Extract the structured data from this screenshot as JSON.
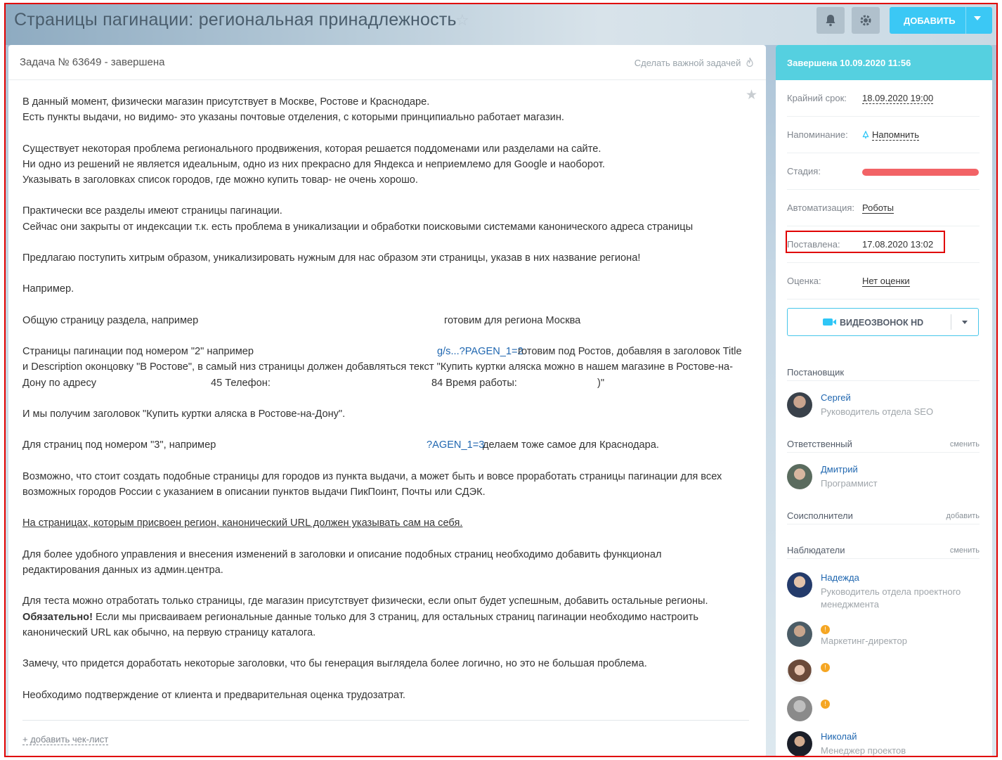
{
  "header": {
    "title": "Страницы пагинации: региональная принадлежность",
    "star_icon": "☆",
    "bell_icon": "bell-icon",
    "gear_icon": "gear-icon",
    "add_button": "ДОБАВИТЬ"
  },
  "task": {
    "number": "Задача № 63649 - завершена",
    "make_important": "Сделать важной задачей",
    "fav_star": "★",
    "lines": {
      "l1": "В данный момент, физически магазин присутствует в Москве, Ростове и Краснодаре.",
      "l2": "Есть пункты выдачи, но видимо- это указаны почтовые отделения, с которыми принципиально работает магазин.",
      "l3": "Существует некоторая проблема регионального продвижения, которая решается поддоменами или разделами на сайте.",
      "l4": "Ни одно из решений не является идеальным, одно из них прекрасно для Яндекса и неприемлемо для Google и наоборот.",
      "l5": "Указывать в заголовках список городов, где можно купить товар- не очень хорошо.",
      "l6": "Практически все разделы имеют страницы пагинации.",
      "l7": "Сейчас они закрыты от индексации т.к. есть проблема в уникализации и обработки поисковыми системами канонического адреса страницы",
      "l8": "Предлагаю поступить хитрым образом, уникализировать нужным для нас образом эти страницы, указав в них название региона!",
      "l9": "Например.",
      "l10a": "Общую страницу раздела, например",
      "l10b": "готовим для региона Москва",
      "l11a": "Страницы пагинации под номером \"2\" например",
      "l11link": "g/s...?PAGEN_1=2",
      "l11b": "готовим под Ростов, добавляя в заголовок Title",
      "l12": "и Description оконцовку \"В Ростове\", в самый низ страницы должен добавляться текст \"Купить куртки аляска можно в нашем магазине в Ростове-на-",
      "l13a": "Дону по адресу",
      "l13b": "45 Телефон:",
      "l13c": "84 Время работы:",
      "l13d": ")\"",
      "l14": "И мы получим заголовок \"Купить куртки аляска в Ростове-на-Дону\".",
      "l15a": "Для страниц под номером \"3\", например",
      "l15link": "?AGEN_1=3",
      "l15b": "делаем тоже самое для Краснодара.",
      "l16": "Возможно, что стоит создать подобные страницы для городов из пункта выдачи, а может быть и вовсе проработать страницы пагинации для всех",
      "l17": "возможных городов России с указанием в описании пунктов выдачи ПикПоинт, Почты или СДЭК.",
      "l18": "На страницах, которым присвоен регион, канонический URL должен указывать сам на себя.",
      "l19": "Для более удобного управления и внесения изменений в заголовки и описание подобных страниц необходимо добавить функционал",
      "l20": "редактирования данных из админ.центра.",
      "l21": "Для теста можно отработать только страницы, где магазин присутствует физически, если опыт будет успешным, добавить остальные регионы.",
      "l22bold": "Обязательно!",
      "l22": " Если мы присваиваем региональные данные только для 3 страниц, для остальных страниц пагинации необходимо настроить",
      "l23": "канонический URL как обычно, на первую страницу каталога.",
      "l24": "Замечу, что придется доработать некоторые заголовки, что бы генерация выглядела более логично, но это не большая проблема.",
      "l25": "Необходимо подтверждение от клиента и предварительная оценка трудозатрат."
    },
    "add_checklist": "+ добавить чек-лист"
  },
  "sidebar": {
    "status": "Завершена 10.09.2020 11:56",
    "deadline_label": "Крайний срок:",
    "deadline_value": "18.09.2020 19:00",
    "reminder_label": "Напоминание:",
    "reminder_value": "Напомнить",
    "stage_label": "Стадия:",
    "stage_color": "#f26366",
    "automation_label": "Автоматизация:",
    "automation_value": "Роботы",
    "created_label": "Поставлена:",
    "created_value": "17.08.2020 13:02",
    "rating_label": "Оценка:",
    "rating_value": "Нет оценки",
    "video_button": "ВИДЕОЗВОНОК HD",
    "creator_title": "Постановщик",
    "creator": {
      "name": "Сергей",
      "role": "Руководитель отдела SEO"
    },
    "responsible_title": "Ответственный",
    "responsible_action": "сменить",
    "responsible": {
      "name": "Дмитрий",
      "role": "Программист"
    },
    "coexec_title": "Соисполнители",
    "coexec_action": "добавить",
    "observers_title": "Наблюдатели",
    "observers_action": "сменить",
    "observers": [
      {
        "name": "Надежда",
        "role": "Руководитель отдела проектного менеджмента"
      },
      {
        "name": "",
        "role": "Маркетинг-директор"
      },
      {
        "name": "",
        "role": ""
      },
      {
        "name": "",
        "role": ""
      },
      {
        "name": "Николай",
        "role": "Менеджер проектов"
      }
    ]
  },
  "accent_color": "#3bc8f5"
}
